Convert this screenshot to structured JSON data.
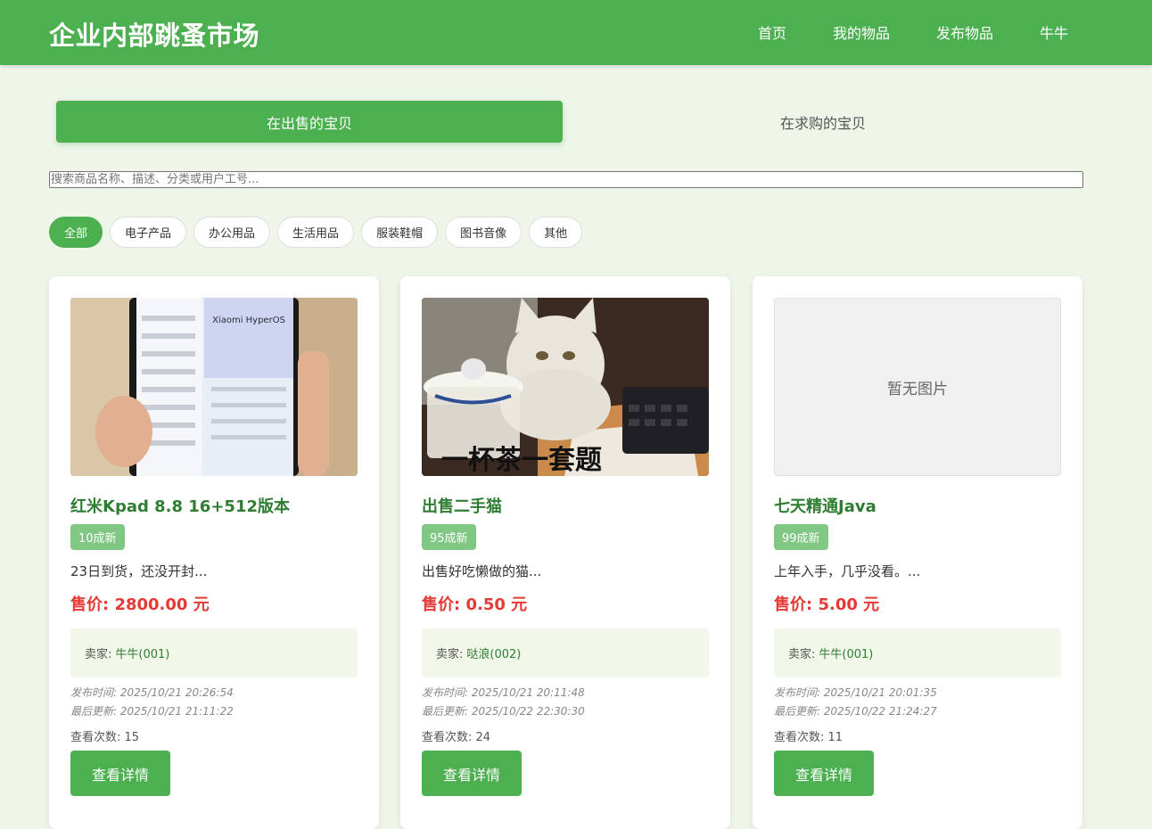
{
  "brand": "企业内部跳蚤市场",
  "nav": [
    "首页",
    "我的物品",
    "发布物品",
    "牛牛"
  ],
  "tabs": {
    "selling": "在出售的宝贝",
    "wanted": "在求购的宝贝"
  },
  "search": {
    "placeholder": "搜索商品名称、描述、分类或用户工号..."
  },
  "categories": [
    "全部",
    "电子产品",
    "办公用品",
    "生活用品",
    "服装鞋帽",
    "图书音像",
    "其他"
  ],
  "labels": {
    "seller_prefix": "卖家:",
    "published_prefix": "发布时间:",
    "updated_prefix": "最后更新:",
    "views_prefix": "查看次数:",
    "detail_button": "查看详情"
  },
  "products": [
    {
      "title": "红米Kpad 8.8 16+512版本",
      "condition": "10成新",
      "description": "23日到货，还没开封...",
      "price": "售价: 2800.00 元",
      "seller": "牛牛(001)",
      "published": "2025/10/21 20:26:54",
      "updated": "2025/10/21 21:11:22",
      "views": "15",
      "image_text": "Xiaomi HyperOS"
    },
    {
      "title": "出售二手猫",
      "condition": "95成新",
      "description": "出售好吃懒做的猫...",
      "price": "售价: 0.50 元",
      "seller": "哒浪(002)",
      "published": "2025/10/21 20:11:48",
      "updated": "2025/10/22 22:30:30",
      "views": "24",
      "image_text": "一杯茶一套题"
    },
    {
      "title": "七天精通Java",
      "condition": "99成新",
      "description": "上年入手，几乎没看。...",
      "price": "售价: 5.00 元",
      "seller": "牛牛(001)",
      "published": "2025/10/21 20:01:35",
      "updated": "2025/10/22 21:24:27",
      "views": "11",
      "image_text": "暂无图片"
    }
  ],
  "colors": {
    "primary": "#4caf50",
    "title_green": "#2e7d32",
    "price_red": "#e53935",
    "page_bg": "#eef5e9"
  }
}
